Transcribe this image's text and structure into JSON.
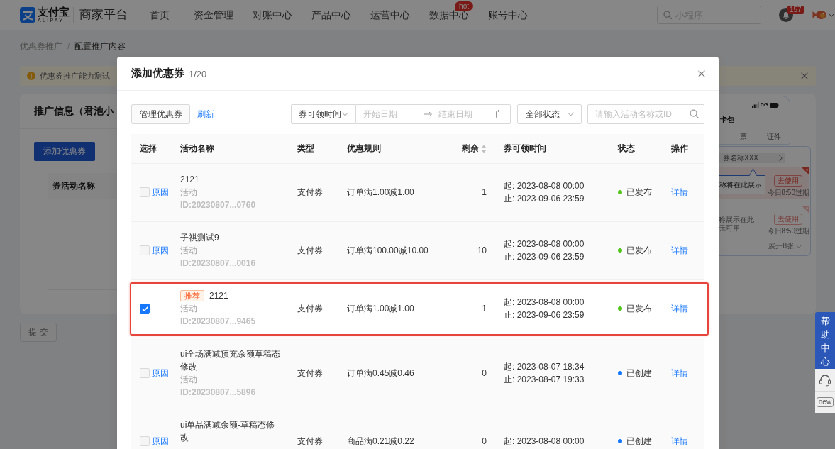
{
  "top_nav": {
    "logo": {
      "name": "支付宝",
      "latin": "ALIPAY"
    },
    "platform": "商家平台",
    "items": [
      {
        "label": "首页"
      },
      {
        "label": "资金管理"
      },
      {
        "label": "对账中心"
      },
      {
        "label": "产品中心"
      },
      {
        "label": "运营中心"
      },
      {
        "label": "数据中心",
        "badge": "hot"
      },
      {
        "label": "账号中心"
      }
    ],
    "search": {
      "placeholder": "小程序"
    },
    "notifications": {
      "count": "157"
    }
  },
  "breadcrumb": {
    "items": [
      "优惠券推广",
      "配置推广内容"
    ],
    "separator": "/"
  },
  "alert": {
    "text": "优惠券推广能力测试"
  },
  "card": {
    "title": "推广信息（君池小",
    "add_button": "添加优惠券",
    "table": {
      "columns": [
        "券活动名称"
      ]
    }
  },
  "preview": {
    "network": "5G",
    "title": "卡包",
    "tabs": [
      "票",
      "证件"
    ],
    "coupon_bar": "券名称XXX",
    "coupons": [
      {
        "highlighted": true,
        "use_button": "去使用",
        "expiry": "今日8:50过期"
      },
      {
        "highlighted": false,
        "name": "称展示在此",
        "condition": "元可用",
        "use_button": "去使用",
        "expiry": "今日8:50过期"
      }
    ],
    "expand": "展开8张",
    "tooltip": "称将在此展示"
  },
  "submit_button": {
    "label": "提 交",
    "disabled": true
  },
  "help_center": {
    "label": "帮助中心",
    "new_label": "new"
  },
  "modal": {
    "title": "添加优惠券",
    "counter": "1/20",
    "toolbar": {
      "manage_button": "管理优惠券",
      "refresh_link": "刷新",
      "time_filter": "券可领时间",
      "start_placeholder": "开始日期",
      "end_placeholder": "结束日期",
      "status_filter": "全部状态",
      "search_placeholder": "请输入活动名称或ID"
    },
    "table": {
      "columns": [
        {
          "label": "选择",
          "sortable": false
        },
        {
          "label": "活动名称",
          "sortable": false
        },
        {
          "label": "类型",
          "sortable": false
        },
        {
          "label": "优惠规则",
          "sortable": false
        },
        {
          "label": "剩余",
          "sortable": true
        },
        {
          "label": "券可领时间",
          "sortable": false
        },
        {
          "label": "状态",
          "sortable": false
        },
        {
          "label": "操作",
          "sortable": false
        }
      ],
      "rows": [
        {
          "checked": false,
          "disabled": true,
          "highlighted": false,
          "reason_link": "原因",
          "name": "2121",
          "subtitle": "活动",
          "id": "ID:20230807...0760",
          "type": "支付券",
          "rule": "订单满1.00减1.00",
          "remaining": "1",
          "start": "起: 2023-08-08 00:00",
          "end": "止: 2023-09-06 23:59",
          "status": {
            "label": "已发布",
            "color": "#52c41a"
          },
          "action": "详情"
        },
        {
          "checked": false,
          "disabled": true,
          "highlighted": false,
          "reason_link": "原因",
          "name": "子祺测试9",
          "subtitle": "活动",
          "id": "ID:20230807...0016",
          "type": "支付券",
          "rule": "订单满100.00减10.00",
          "remaining": "10",
          "start": "起: 2023-08-08 00:00",
          "end": "止: 2023-09-06 23:59",
          "status": {
            "label": "已发布",
            "color": "#52c41a"
          },
          "action": "详情"
        },
        {
          "checked": true,
          "disabled": false,
          "highlighted": true,
          "tag": "推荐",
          "name": "2121",
          "subtitle": "活动",
          "id": "ID:20230807...9465",
          "type": "支付券",
          "rule": "订单满1.00减1.00",
          "remaining": "1",
          "start": "起: 2023-08-08 00:00",
          "end": "止: 2023-09-06 23:59",
          "status": {
            "label": "已发布",
            "color": "#52c41a"
          },
          "action": "详情"
        },
        {
          "checked": false,
          "disabled": true,
          "highlighted": false,
          "reason_link": "原因",
          "name": "ui全场满减预充余额草稿态修改",
          "subtitle": "活动",
          "id": "ID:20230807...5896",
          "type": "支付券",
          "rule": "订单满0.45减0.46",
          "remaining": "0",
          "start": "起: 2023-08-07 18:34",
          "end": "止: 2023-08-07 19:33",
          "status": {
            "label": "已创建",
            "color": "#1677ff"
          },
          "action": "详情"
        },
        {
          "checked": false,
          "disabled": true,
          "highlighted": false,
          "reason_link": "原因",
          "name": "ui单品满减余额-草稿态修改",
          "type": "支付券",
          "rule": "商品满0.21减0.22",
          "remaining": "0",
          "start": "起: 2023-08-08 00:00",
          "status": {
            "label": "已创建",
            "color": "#1677ff"
          },
          "action": "详情"
        }
      ]
    }
  }
}
